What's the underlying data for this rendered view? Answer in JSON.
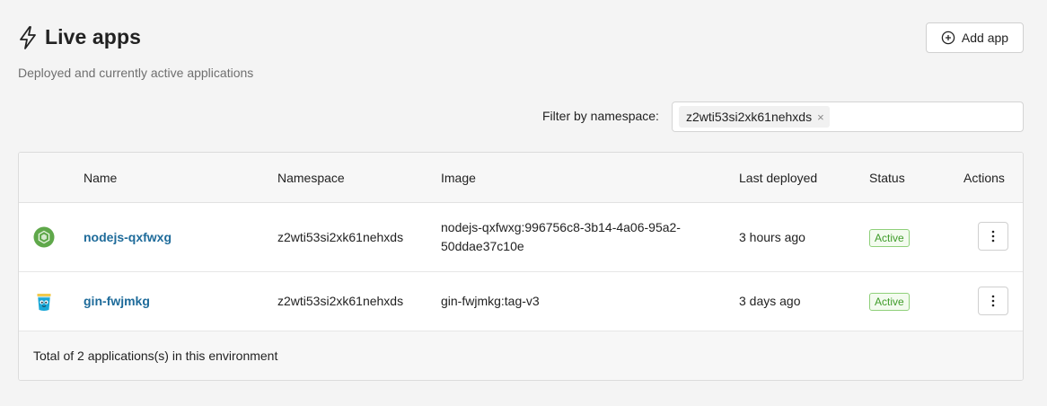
{
  "header": {
    "title": "Live apps",
    "subtitle": "Deployed and currently active applications",
    "icon": "lightning-bolt-icon"
  },
  "toolbar": {
    "add_label": "Add app",
    "add_icon": "plus-circle-icon"
  },
  "filter": {
    "label": "Filter by namespace:",
    "chips": [
      "z2wti53si2xk61nehxds"
    ],
    "remove_glyph": "×"
  },
  "table": {
    "columns": [
      "Name",
      "Namespace",
      "Image",
      "Last deployed",
      "Status",
      "Actions"
    ],
    "rows": [
      {
        "icon": "nodejs-logo-icon",
        "name": "nodejs-qxfwxg",
        "namespace": "z2wti53si2xk61nehxds",
        "image_line1": "nodejs-qxfwxg:996756c8-3b14-4a06-95a2-",
        "image_line2": "50ddae37c10e",
        "last_deployed": "3 hours ago",
        "status": "Active"
      },
      {
        "icon": "gin-logo-icon",
        "name": "gin-fwjmkg",
        "namespace": "z2wti53si2xk61nehxds",
        "image_line1": "gin-fwjmkg:tag-v3",
        "last_deployed": "3 days ago",
        "status": "Active"
      }
    ],
    "footer": "Total of 2 applications(s) in this environment"
  },
  "colors": {
    "link": "#1e6b9a",
    "status_active": "#3f9c2a",
    "nodejs_green": "#5fa84a",
    "gin_blue": "#1aa7d6"
  }
}
